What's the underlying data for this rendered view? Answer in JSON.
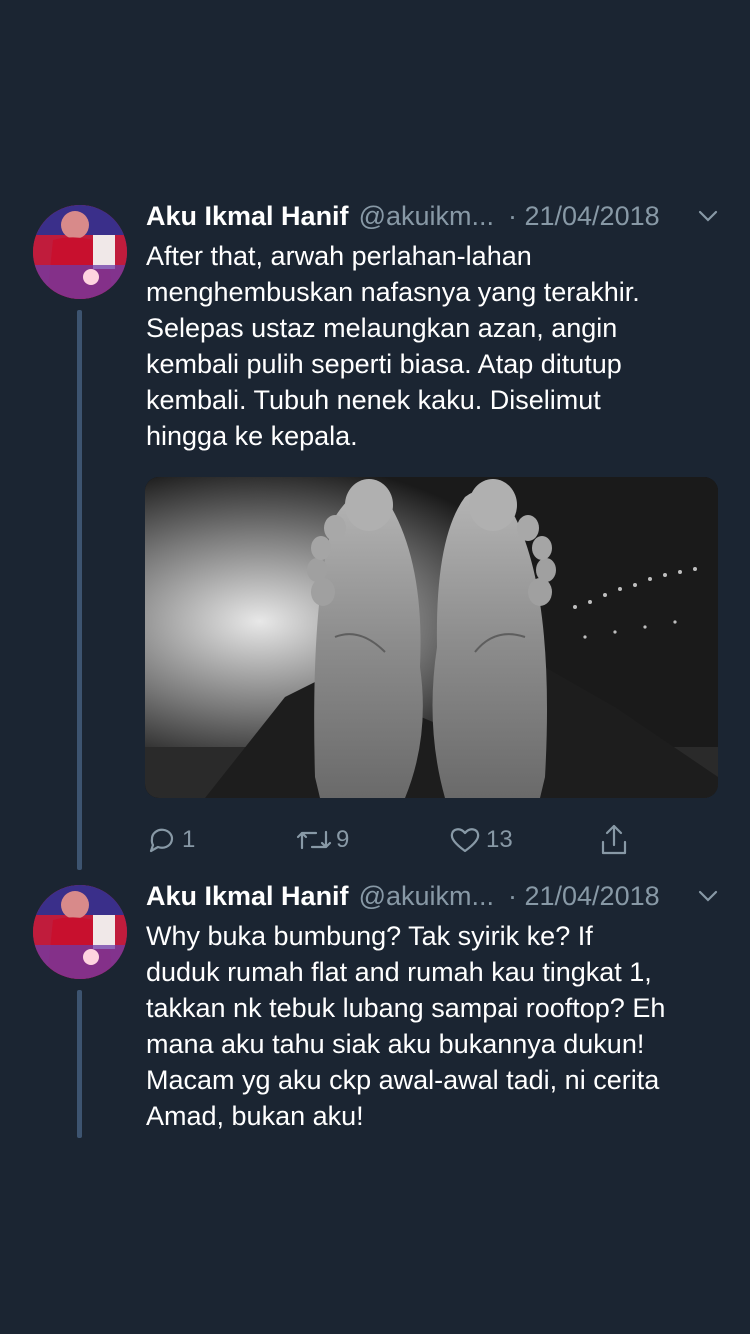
{
  "tweets": [
    {
      "name": "Aku Ikmal Hanif",
      "handle": "@akuikm...",
      "date": "· 21/04/2018",
      "text": "After that, arwah perlahan-lahan\nmenghembuskan nafasnya yang terakhir.\nSelepas ustaz melaungkan azan, angin\nkembali pulih seperti biasa. Atap ditutup\nkembali. Tubuh nenek kaku. Diselimut\nhingga ke kepala.",
      "replies": "1",
      "retweets": "9",
      "likes": "13"
    },
    {
      "name": "Aku Ikmal Hanif",
      "handle": "@akuikm...",
      "date": "· 21/04/2018",
      "text": "Why buka bumbung? Tak syirik ke? If\nduduk rumah flat and rumah kau tingkat 1,\ntakkan nk tebuk lubang sampai rooftop? Eh\nmana aku tahu siak aku bukannya dukun!\nMacam yg aku ckp awal-awal tadi, ni cerita\nAmad, bukan aku!"
    }
  ],
  "icons": {
    "reply": "reply-icon",
    "retweet": "retweet-icon",
    "like": "like-icon",
    "share": "share-icon",
    "menu": "chevron-down-icon"
  },
  "colors": {
    "background": "#1b2532",
    "secondary_text": "#8899a6",
    "thread_line": "#3d5470"
  }
}
